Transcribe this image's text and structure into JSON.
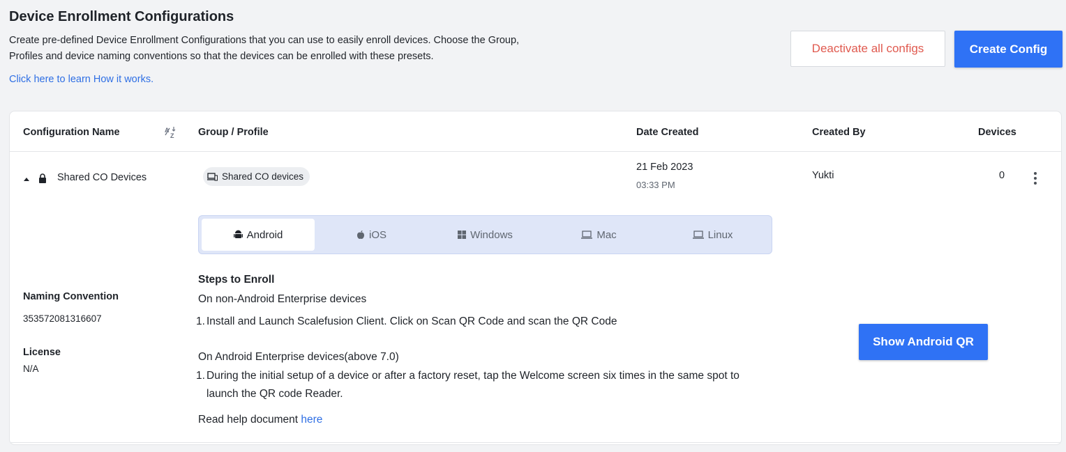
{
  "header": {
    "title": "Device Enrollment Configurations",
    "description": "Create pre-defined Device Enrollment Configurations that you can use to easily enroll devices. Choose the Group, Profiles and device naming conventions so that the devices can be enrolled with these presets.",
    "learn_link": "Click here to learn How it works.",
    "deactivate_label": "Deactivate all configs",
    "create_label": "Create Config"
  },
  "table": {
    "columns": [
      "Configuration Name",
      "Group / Profile",
      "Date Created",
      "Created By",
      "Devices"
    ],
    "row": {
      "name": "Shared CO Devices",
      "group": "Shared CO devices",
      "date": "21 Feb 2023",
      "time": "03:33 PM",
      "created_by": "Yukti",
      "devices": "0"
    }
  },
  "details": {
    "tabs": [
      "Android",
      "iOS",
      "Windows",
      "Mac",
      "Linux"
    ],
    "active_tab": "Android",
    "steps_title": "Steps to Enroll",
    "non_ae_title": "On non-Android Enterprise devices",
    "non_ae_step": "Install and Launch Scalefusion Client. Click on Scan QR Code and scan the QR Code",
    "ae_title": "On Android Enterprise devices(above 7.0)",
    "ae_step_line1": "During the initial setup of a device or after a factory reset, tap the Welcome screen six times in the same spot to",
    "ae_step_line2": "launch the QR code Reader.",
    "help_prefix": "Read help document",
    "help_link": "here",
    "naming_label": "Naming Convention",
    "naming_value": "353572081316607",
    "license_label": "License",
    "license_value": "N/A",
    "qr_button": "Show Android QR"
  },
  "colors": {
    "primary": "#2f72f5",
    "danger": "#e05a4f",
    "link": "#2f6fe4"
  }
}
